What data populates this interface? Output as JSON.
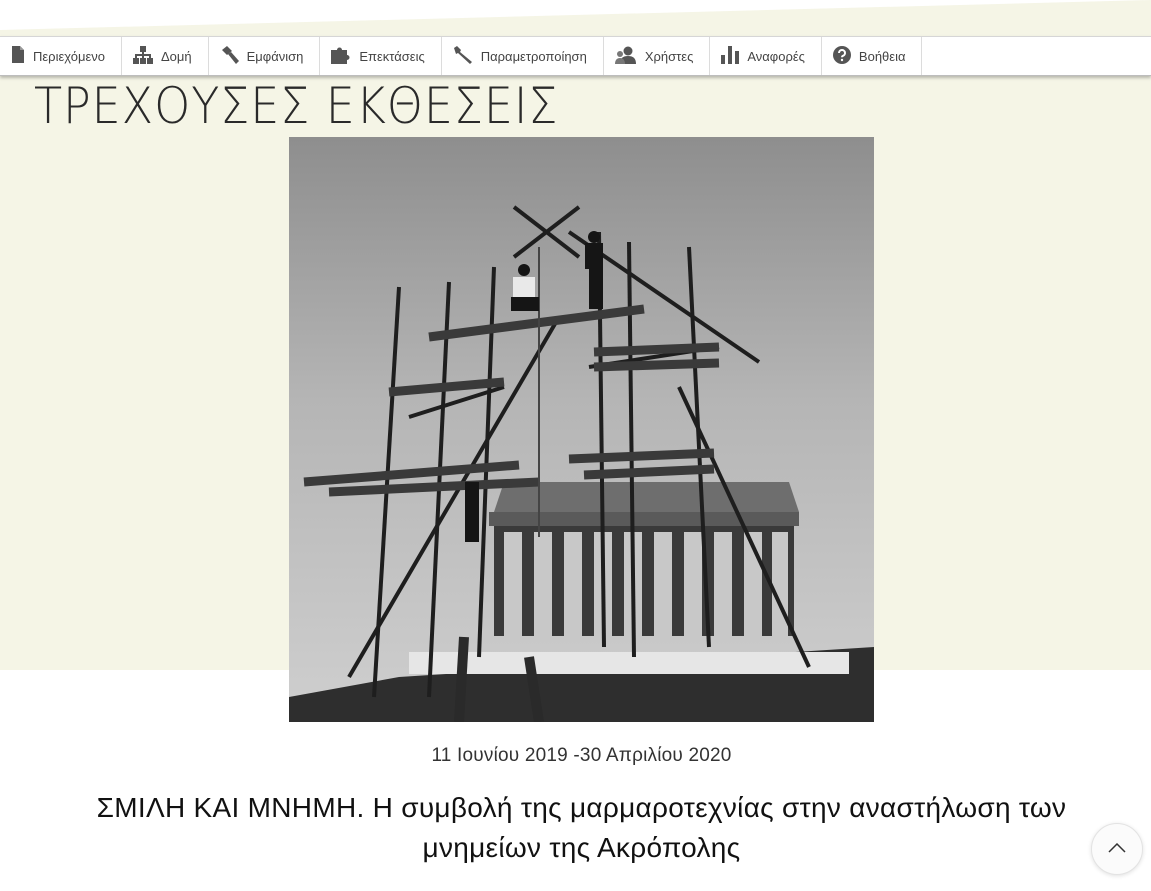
{
  "toolbar": {
    "items": [
      {
        "label": "Περιεχόμενο",
        "icon": "document-icon"
      },
      {
        "label": "Δομή",
        "icon": "sitemap-icon"
      },
      {
        "label": "Εμφάνιση",
        "icon": "paintbrush-icon"
      },
      {
        "label": "Επεκτάσεις",
        "icon": "puzzle-icon"
      },
      {
        "label": "Παραμετροποίηση",
        "icon": "wrench-icon"
      },
      {
        "label": "Χρήστες",
        "icon": "users-icon"
      },
      {
        "label": "Αναφορές",
        "icon": "bar-chart-icon"
      },
      {
        "label": "Βοήθεια",
        "icon": "help-icon"
      }
    ]
  },
  "page": {
    "title": "ΤΡΕΧΟΥΣΕΣ ΕΚΘΕΣΕΙΣ"
  },
  "exhibition": {
    "image_subject": "black-and-white photo of workers on scaffolding in front of the Parthenon",
    "dates": "11 Ιουνίου 2019 -30 Απριλίου 2020",
    "title": "ΣΜΙΛΗ ΚΑΙ ΜΝΗΜΗ. Η συμβολή της μαρμαροτεχνίας στην αναστήλωση των μνημείων της Ακρόπολης"
  },
  "colors": {
    "hero_background": "#f5f5e6",
    "toolbar_background": "#ffffff",
    "text": "#222222"
  }
}
